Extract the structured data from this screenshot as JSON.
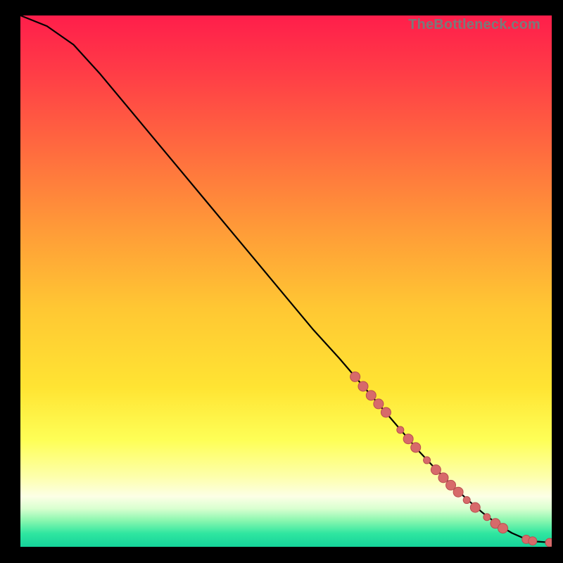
{
  "watermark": "TheBottleneck.com",
  "colors": {
    "frame": "#000000",
    "curve": "#000000",
    "marker_fill": "#d76a6a",
    "marker_stroke": "#b94f4f",
    "gradient_stops": [
      {
        "offset": 0.0,
        "color": "#ff1e4b"
      },
      {
        "offset": 0.1,
        "color": "#ff3a47"
      },
      {
        "offset": 0.25,
        "color": "#ff6a3f"
      },
      {
        "offset": 0.4,
        "color": "#ff9a38"
      },
      {
        "offset": 0.55,
        "color": "#ffc733"
      },
      {
        "offset": 0.7,
        "color": "#ffe433"
      },
      {
        "offset": 0.8,
        "color": "#feff57"
      },
      {
        "offset": 0.87,
        "color": "#fdffae"
      },
      {
        "offset": 0.905,
        "color": "#fcffe6"
      },
      {
        "offset": 0.928,
        "color": "#d9ffd0"
      },
      {
        "offset": 0.95,
        "color": "#8cf7b0"
      },
      {
        "offset": 0.975,
        "color": "#2fe6a0"
      },
      {
        "offset": 1.0,
        "color": "#15d39a"
      }
    ]
  },
  "chart_data": {
    "type": "line",
    "title": "",
    "xlabel": "",
    "ylabel": "",
    "xlim": [
      0,
      100
    ],
    "ylim": [
      0,
      100
    ],
    "series": [
      {
        "name": "curve",
        "x": [
          0,
          5,
          10,
          15,
          20,
          25,
          30,
          35,
          40,
          45,
          50,
          55,
          60,
          63,
          66,
          69,
          72,
          75,
          78,
          81,
          84,
          87,
          90,
          92.5,
          95,
          97,
          100
        ],
        "y": [
          100,
          98,
          94.5,
          89,
          83,
          77,
          71,
          65,
          59,
          53,
          47,
          41,
          35.5,
          32,
          28.5,
          25,
          21.5,
          18,
          14.8,
          11.8,
          9,
          6.4,
          4.1,
          2.6,
          1.5,
          1.0,
          0.8
        ]
      }
    ],
    "markers": [
      {
        "x": 63.0,
        "y": 32.0,
        "r": 7
      },
      {
        "x": 64.5,
        "y": 30.2,
        "r": 7
      },
      {
        "x": 66.0,
        "y": 28.5,
        "r": 7
      },
      {
        "x": 67.4,
        "y": 26.9,
        "r": 7
      },
      {
        "x": 68.8,
        "y": 25.3,
        "r": 7
      },
      {
        "x": 71.5,
        "y": 22.0,
        "r": 5
      },
      {
        "x": 73.0,
        "y": 20.3,
        "r": 7
      },
      {
        "x": 74.4,
        "y": 18.7,
        "r": 7
      },
      {
        "x": 76.5,
        "y": 16.3,
        "r": 5
      },
      {
        "x": 78.2,
        "y": 14.5,
        "r": 7
      },
      {
        "x": 79.6,
        "y": 13.0,
        "r": 7
      },
      {
        "x": 81.0,
        "y": 11.6,
        "r": 7
      },
      {
        "x": 82.4,
        "y": 10.3,
        "r": 7
      },
      {
        "x": 84.0,
        "y": 8.8,
        "r": 5
      },
      {
        "x": 85.6,
        "y": 7.4,
        "r": 7
      },
      {
        "x": 87.8,
        "y": 5.6,
        "r": 5
      },
      {
        "x": 89.4,
        "y": 4.4,
        "r": 7
      },
      {
        "x": 90.8,
        "y": 3.5,
        "r": 7
      },
      {
        "x": 95.2,
        "y": 1.4,
        "r": 6
      },
      {
        "x": 96.4,
        "y": 1.1,
        "r": 6
      },
      {
        "x": 99.6,
        "y": 0.8,
        "r": 6
      }
    ]
  }
}
